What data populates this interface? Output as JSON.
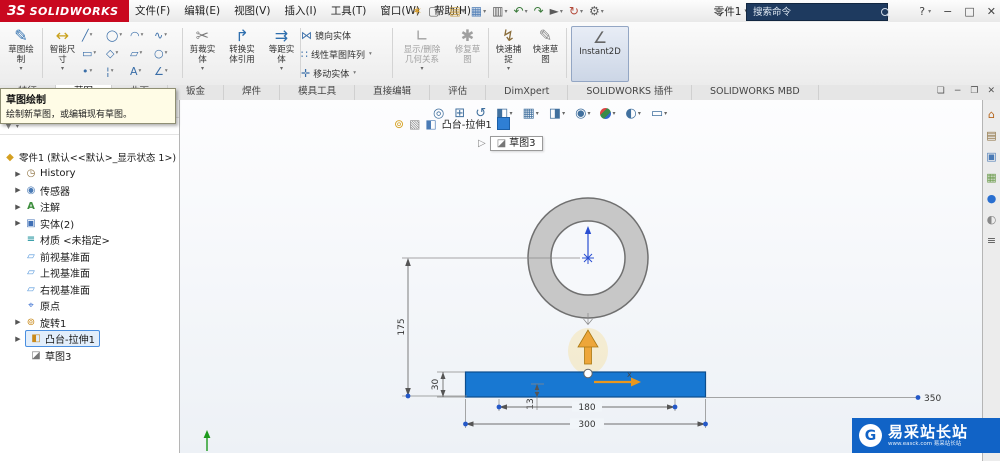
{
  "titlebar": {
    "logo_3ds": "ЗS",
    "logo_brand": "SOLIDWORKS",
    "menus": [
      "文件(F)",
      "编辑(E)",
      "视图(V)",
      "插入(I)",
      "工具(T)",
      "窗口(W)",
      "帮助(H)"
    ],
    "doc_title": "零件1",
    "search_placeholder": "搜索命令",
    "help_label": "?"
  },
  "ribbon": {
    "sketch_l1": "草图绘",
    "sketch_l2": "制",
    "smartdim_l1": "智能尺",
    "smartdim_l2": "寸",
    "trim_l1": "剪裁实",
    "trim_l2": "体",
    "convert_l1": "转换实",
    "convert_l2": "体引用",
    "offset_l1": "等距实",
    "offset_l2": "体",
    "mirror": "镜向实体",
    "linear_pattern": "线性草图阵列",
    "move": "移动实体",
    "relations_l1": "显示/删除",
    "relations_l2": "几何关系",
    "repair_l1": "修复草",
    "repair_l2": "图",
    "quicksnap_l1": "快速捕",
    "quicksnap_l2": "捉",
    "rapidsketch_l1": "快速草",
    "rapidsketch_l2": "图",
    "instant2d": "Instant2D"
  },
  "tabs": [
    "特征",
    "草图",
    "曲面",
    "钣金",
    "焊件",
    "模具工具",
    "直接编辑",
    "评估",
    "DimXpert",
    "SOLIDWORKS 插件",
    "SOLIDWORKS MBD"
  ],
  "tooltip": {
    "title": "草图绘制",
    "body": "绘制新草图，或编辑现有草图。"
  },
  "tree": {
    "root": "零件1 (默认<<默认>_显示状态 1>)",
    "items": [
      "History",
      "传感器",
      "注解",
      "实体(2)",
      "材质 <未指定>",
      "前视基准面",
      "上视基准面",
      "右视基准面",
      "原点",
      "旋转1",
      "凸台-拉伸1",
      "草图3"
    ]
  },
  "breadcrumb": {
    "feature": "凸台-拉伸1",
    "sketch": "草图3"
  },
  "drawing": {
    "d175": "175",
    "d30": "30",
    "d13": "13",
    "d180": "180",
    "d300": "300",
    "d350": "350",
    "x_label": "x"
  },
  "watermark": {
    "title": "易采站长站",
    "subtitle": "www.easck.com 易采站长站",
    "logo_letter": "G"
  },
  "colors": {
    "brand_red": "#c9081f",
    "sketch_blue": "#1878d2",
    "arrow_orange": "#eda63a",
    "watermark_blue": "#1163c6",
    "selection_blue": "#3a7bd5"
  },
  "icons": {
    "caret": "▾",
    "flyout": "»",
    "expand": "▶",
    "star": "✶",
    "new_doc": "▢",
    "open": "▤",
    "save": "▦",
    "print": "▥",
    "undo": "↶",
    "redo": "↷",
    "select": "►",
    "rebuild": "↻",
    "options": "⚙",
    "minimize": "−",
    "maximize": "□",
    "close": "✕",
    "restore": "❐",
    "winmenu": "❏",
    "sketch": "✎",
    "smartdim": "↔",
    "line": "╱",
    "circle": "◯",
    "arc": "◠",
    "spline": "∿",
    "rect": "▭",
    "polygon": "◇",
    "slot": "▱",
    "ellipse": "○",
    "point": "•",
    "centerline": "¦",
    "text": "A",
    "chamfer": "∠",
    "trim": "✂",
    "convert": "↱",
    "offset": "⇉",
    "mirror": "⋈",
    "pattern": "∷",
    "move": "✛",
    "relations": "∟",
    "repair": "✱",
    "quicksnap": "↯",
    "instant2d": "∠",
    "ltab1": "❖",
    "ltab2": "✦",
    "ltab3": "⊞",
    "ltab4": "△",
    "ltab5": "◎",
    "funnel": "▼",
    "part": "◆",
    "history": "◷",
    "sensor": "◉",
    "annot": "A",
    "solids": "▣",
    "material": "≡",
    "plane": "▱",
    "origin": "⌖",
    "revolve": "⊚",
    "extrude": "◧",
    "sketchitem": "◪",
    "bc1": "⊚",
    "bc2": "▧",
    "bc3": "◧",
    "bc_arrow": "▷",
    "hud1": "◎",
    "hud2": "⊞",
    "hud3": "↺",
    "hud4": "◧",
    "hud5": "▦",
    "hud6": "◨",
    "hud7": "◉",
    "hud9": "◐",
    "hud10": "▭",
    "rs1": "⌂",
    "rs2": "▤",
    "rs3": "▣",
    "rs4": "▦",
    "rs5": "●",
    "rs6": "◐",
    "rs7": "≡"
  }
}
